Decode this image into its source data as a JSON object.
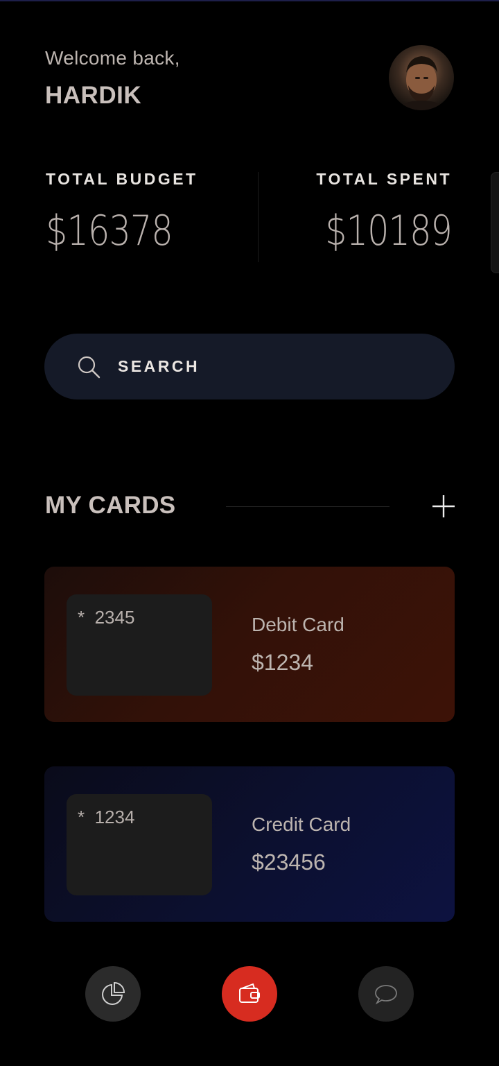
{
  "header": {
    "welcome": "Welcome back,",
    "username": "HARDIK",
    "avatar_icon": "user-avatar"
  },
  "stats": {
    "budget_label": "TOTAL BUDGET",
    "budget_value": "$16378",
    "spent_label": "TOTAL SPENT",
    "spent_value": "$10189"
  },
  "search": {
    "label": "SEARCH",
    "icon": "search-icon"
  },
  "cards_section": {
    "title": "MY CARDS",
    "add_icon": "plus-icon",
    "cards": [
      {
        "number": "*  2345",
        "name": "Debit Card",
        "amount": "$1234",
        "accent": "#3d1207"
      },
      {
        "number": "*  1234",
        "name": "Credit Card",
        "amount": "$23456",
        "accent": "#0d1240"
      }
    ]
  },
  "bottom_nav": {
    "items": [
      {
        "icon": "pie-chart-icon"
      },
      {
        "icon": "wallet-icon",
        "active": true,
        "accent": "#d72c20"
      },
      {
        "icon": "chat-bubble-icon"
      }
    ]
  }
}
